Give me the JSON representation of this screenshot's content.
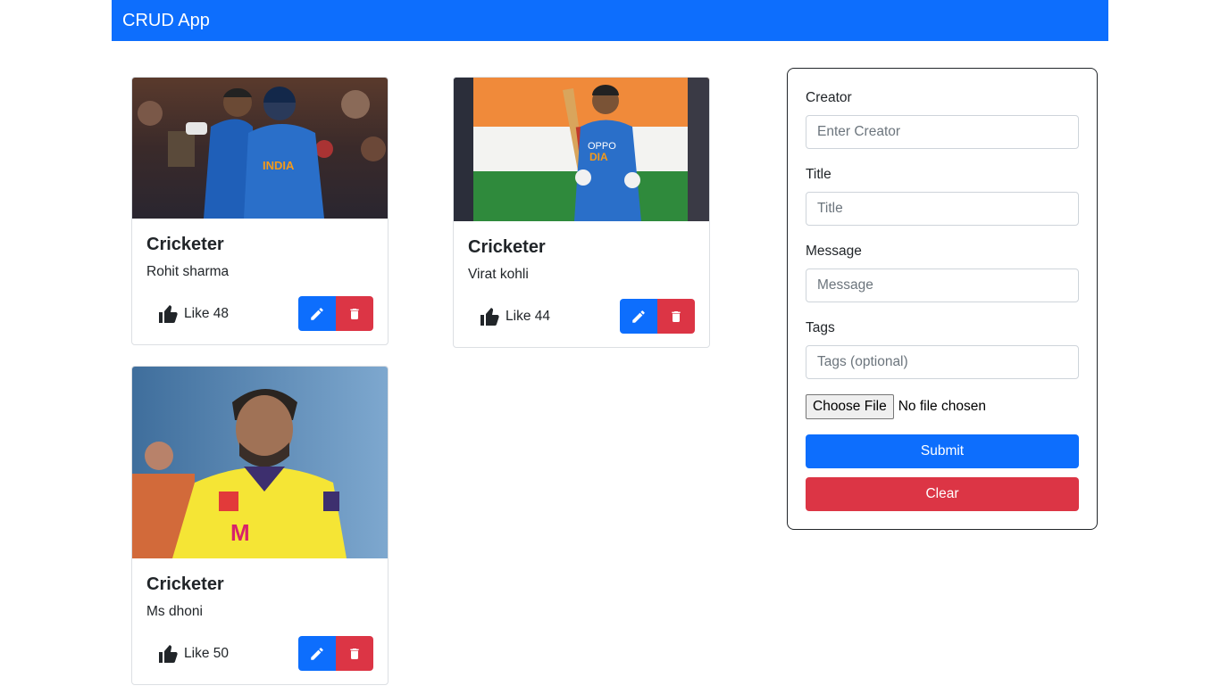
{
  "app": {
    "brand": "CRUD App"
  },
  "posts": [
    {
      "title": "Cricketer",
      "message": "Rohit sharma",
      "like_label": "Like 48"
    },
    {
      "title": "Cricketer",
      "message": "Virat kohli",
      "like_label": "Like 44"
    },
    {
      "title": "Cricketer",
      "message": "Ms dhoni",
      "like_label": "Like 50"
    }
  ],
  "form": {
    "creator_label": "Creator",
    "creator_placeholder": "Enter Creator",
    "title_label": "Title",
    "title_placeholder": "Title",
    "message_label": "Message",
    "message_placeholder": "Message",
    "tags_label": "Tags",
    "tags_placeholder": "Tags (optional)",
    "file_button": "Choose File",
    "file_status": "No file chosen",
    "submit_label": "Submit",
    "clear_label": "Clear"
  },
  "icons": {
    "like": "thumbs-up-icon",
    "edit": "pencil-icon",
    "delete": "trash-icon"
  },
  "colors": {
    "primary": "#0d6efd",
    "danger": "#dc3545",
    "text": "#212529"
  }
}
